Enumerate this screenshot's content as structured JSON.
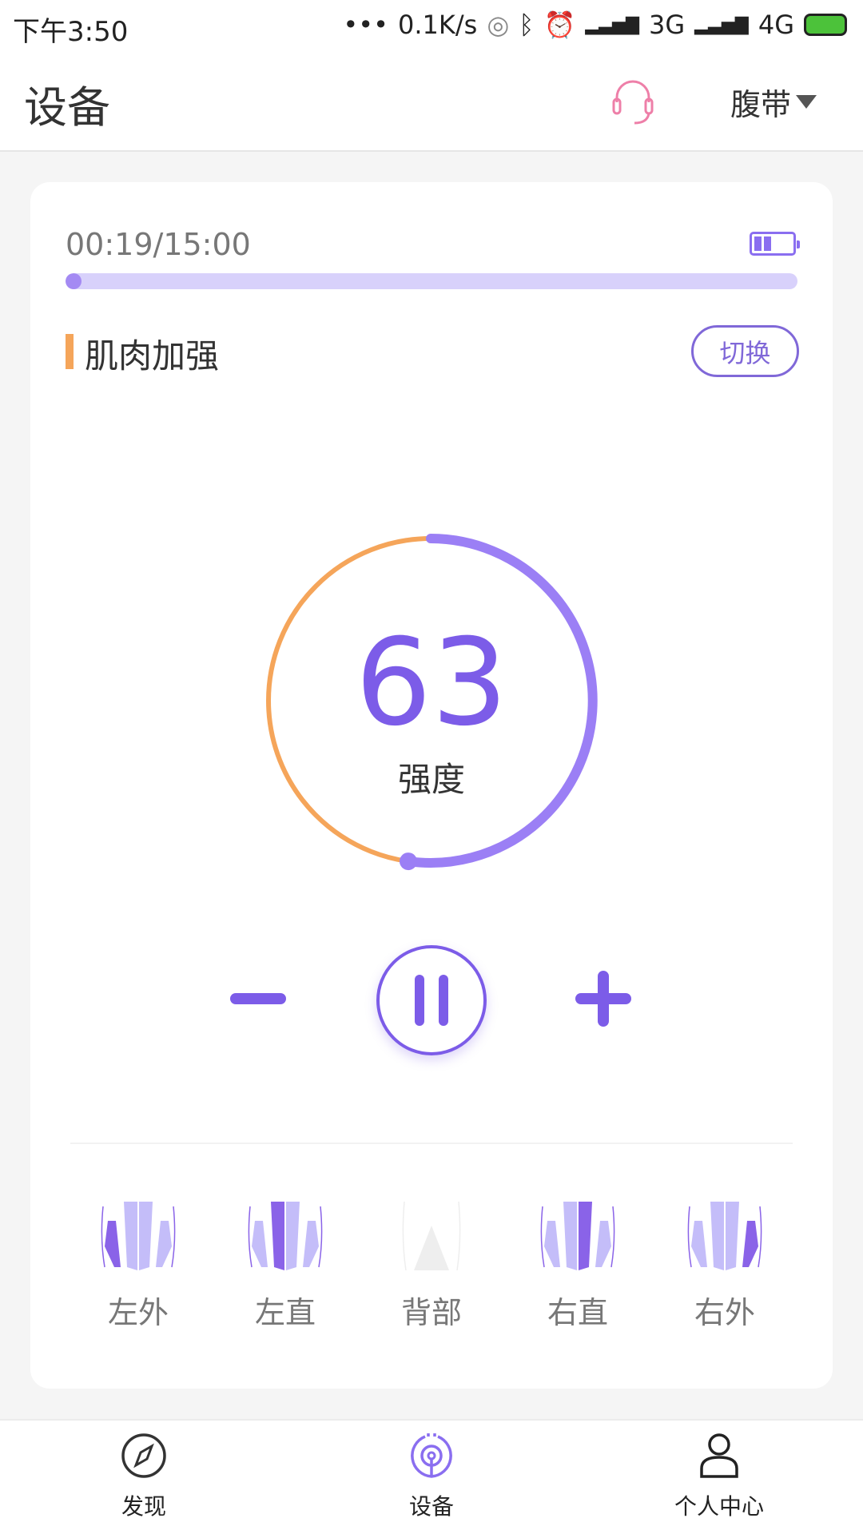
{
  "status_bar": {
    "time": "下午3:50",
    "dots": "•••",
    "net_speed": "0.1K/s",
    "net1": "3G",
    "net2": "4G"
  },
  "header": {
    "title": "设备",
    "device_select": "腹带",
    "icons": [
      "headset-icon",
      "caret-down-icon"
    ]
  },
  "session": {
    "timer": "00:19/15:00",
    "progress_fraction": 0.021,
    "device_battery": "half"
  },
  "mode": {
    "name": "肌肉加强",
    "switch_label": "切换"
  },
  "intensity": {
    "value": "63",
    "label": "强度",
    "arc_fraction": 0.522
  },
  "controls": {
    "icons": [
      "minus-icon",
      "pause-icon",
      "plus-icon"
    ]
  },
  "zones": [
    {
      "label": "左外",
      "active": "left-outer",
      "enabled": true
    },
    {
      "label": "左直",
      "active": "left-straight",
      "enabled": true
    },
    {
      "label": "背部",
      "active": "back",
      "enabled": false
    },
    {
      "label": "右直",
      "active": "right-straight",
      "enabled": true
    },
    {
      "label": "右外",
      "active": "right-outer",
      "enabled": true
    }
  ],
  "nav": [
    {
      "label": "发现",
      "icon": "compass-icon"
    },
    {
      "label": "设备",
      "icon": "device-icon",
      "active": true
    },
    {
      "label": "个人中心",
      "icon": "person-icon"
    }
  ],
  "colors": {
    "accent": "#7c5ce8",
    "accent_light": "#d8d1fb",
    "orange": "#f5a55a",
    "headset": "#ee7fa8"
  }
}
